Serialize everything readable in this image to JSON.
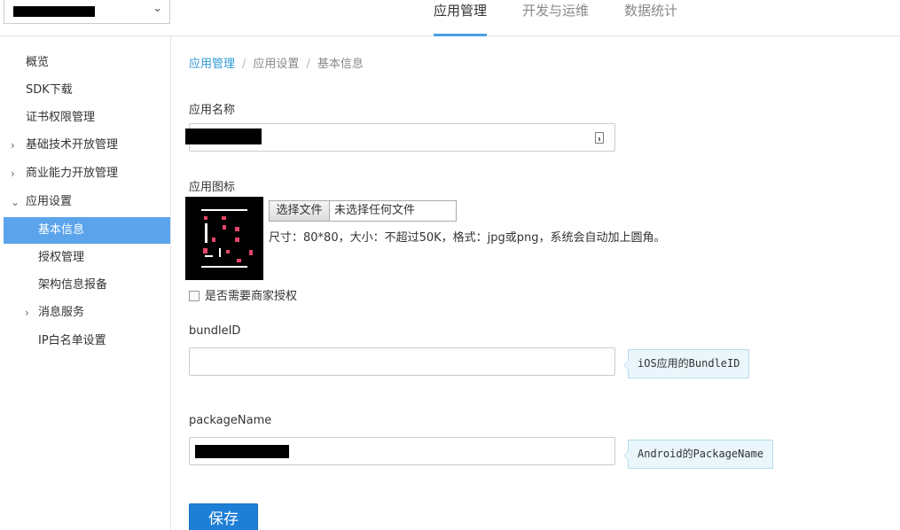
{
  "header": {
    "app_selector_chevron": "⌄",
    "tabs": [
      {
        "label": "应用管理",
        "active": true
      },
      {
        "label": "开发与运维",
        "active": false
      },
      {
        "label": "数据统计",
        "active": false
      }
    ],
    "accent_color": "#4a9ee6"
  },
  "sidebar": {
    "items": [
      {
        "label": "概览"
      },
      {
        "label": "SDK下载"
      },
      {
        "label": "证书权限管理"
      },
      {
        "label": "基础技术开放管理",
        "arrow": "›"
      },
      {
        "label": "商业能力开放管理",
        "arrow": "›"
      },
      {
        "label": "应用设置",
        "arrow": "⌄"
      },
      {
        "label": "基本信息",
        "active": true
      },
      {
        "label": "授权管理"
      },
      {
        "label": "架构信息报备"
      },
      {
        "label": "消息服务",
        "arrow": "›"
      },
      {
        "label": "IP白名单设置"
      }
    ],
    "active_color": "#5ba4ec"
  },
  "breadcrumb": {
    "items": [
      "应用管理",
      "应用设置",
      "基本信息"
    ],
    "separator": "/"
  },
  "form": {
    "app_name_label": "应用名称",
    "app_icon_label": "应用图标",
    "file_button": "选择文件",
    "file_status": "未选择任何文件",
    "icon_hint": "尺寸：80*80，大小：不超过50K，格式：jpg或png，系统会自动加上圆角。",
    "merchant_auth_label": "是否需要商家授权",
    "merchant_auth_checked": false,
    "bundle_label": "bundleID",
    "bundle_value": "",
    "bundle_tip": "iOS应用的BundleID",
    "package_label": "packageName",
    "package_tip": "Android的PackageName",
    "save_button": "保存",
    "save_color": "#1e7fd6"
  }
}
